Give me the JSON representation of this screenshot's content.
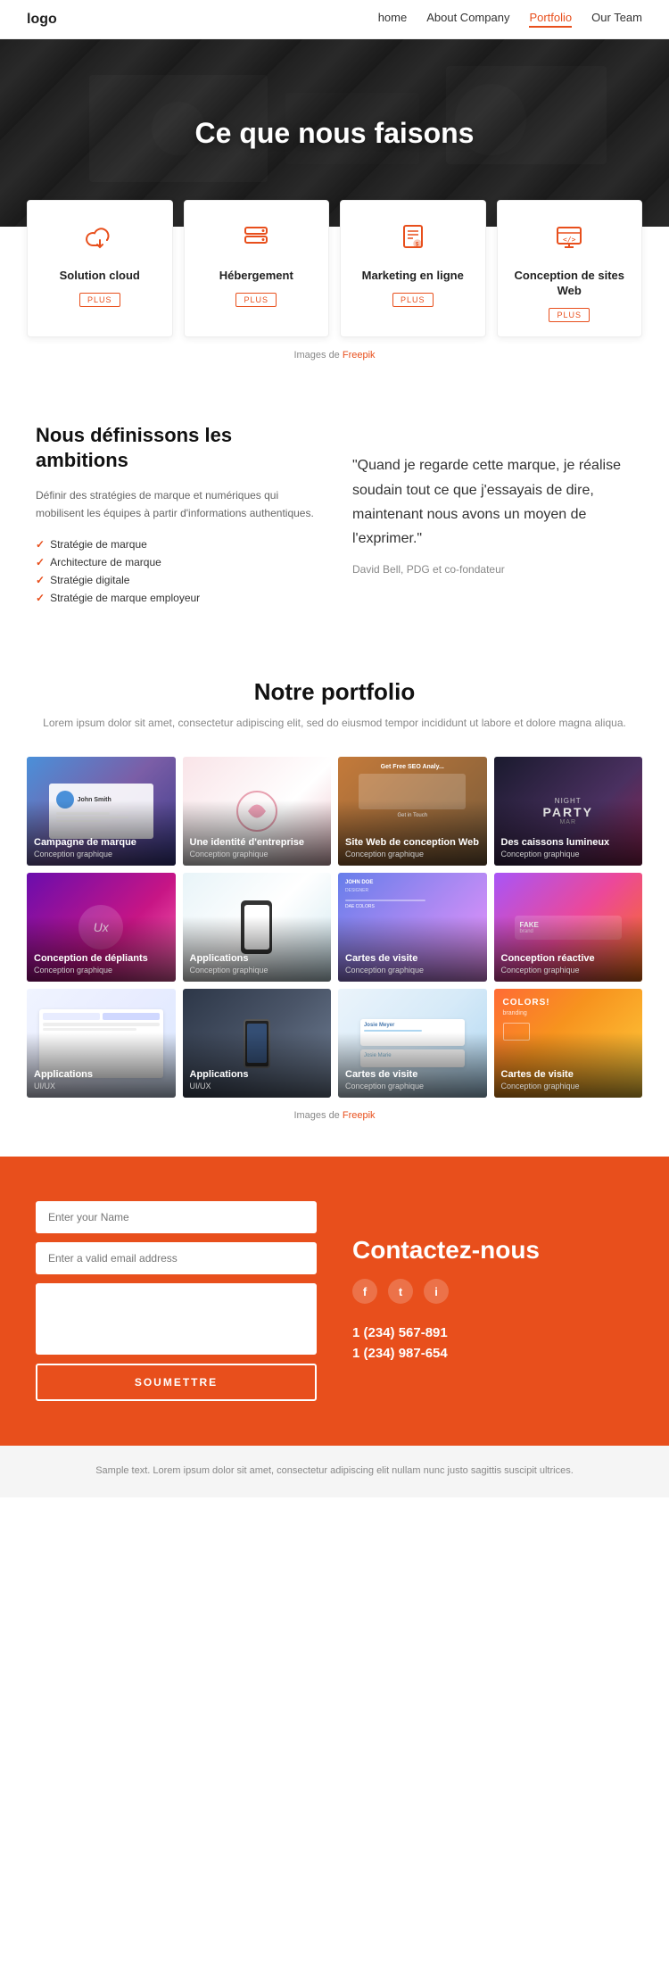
{
  "navbar": {
    "logo": "logo",
    "links": [
      {
        "label": "home",
        "href": "#",
        "active": false
      },
      {
        "label": "About Company",
        "href": "#",
        "active": false
      },
      {
        "label": "Portfolio",
        "href": "#",
        "active": true
      },
      {
        "label": "Our Team",
        "href": "#",
        "active": false
      }
    ]
  },
  "hero": {
    "title": "Ce que nous faisons"
  },
  "services": {
    "items": [
      {
        "icon": "☁",
        "title": "Solution cloud",
        "plus": "PLUS"
      },
      {
        "icon": "▤",
        "title": "Hébergement",
        "plus": "PLUS"
      },
      {
        "icon": "☰",
        "title": "Marketing en ligne",
        "plus": "PLUS"
      },
      {
        "icon": "</>",
        "title": "Conception de sites Web",
        "plus": "PLUS"
      }
    ],
    "credit": "Images de ",
    "credit_link": "Freepik"
  },
  "about": {
    "left_title": "Nous définissons les ambitions",
    "left_desc": "Définir des stratégies de marque et numériques qui mobilisent les équipes à partir d'informations authentiques.",
    "list_items": [
      "Stratégie de marque",
      "Architecture de marque",
      "Stratégie digitale",
      "Stratégie de marque employeur"
    ],
    "quote": "\"Quand je regarde cette marque, je réalise soudain tout ce que j'essayais de dire, maintenant nous avons un moyen de l'exprimer.\"",
    "quote_author": "David Bell, PDG et co-fondateur"
  },
  "portfolio": {
    "title": "Notre portfolio",
    "subtitle": "Lorem ipsum dolor sit amet, consectetur adipiscing elit, sed do eiusmod tempor incididunt ut labore et dolore magna aliqua.",
    "items": [
      {
        "name": "Campagne de marque",
        "cat": "Conception graphique",
        "bg": "bg-blue-purple"
      },
      {
        "name": "Une identité d'entreprise",
        "cat": "Conception graphique",
        "bg": "bg-pink-white"
      },
      {
        "name": "Site Web de conception Web",
        "cat": "Conception graphique",
        "bg": "bg-photo"
      },
      {
        "name": "Des caissons lumineux",
        "cat": "Conception graphique",
        "bg": "bg-dark-party"
      },
      {
        "name": "Conception de dépliants",
        "cat": "Conception graphique",
        "bg": "bg-purple-vivid"
      },
      {
        "name": "Applications",
        "cat": "Conception graphique",
        "bg": "bg-phone-white"
      },
      {
        "name": "Cartes de visite",
        "cat": "Conception graphique",
        "bg": "bg-colorful-card"
      },
      {
        "name": "Conception réactive",
        "cat": "Conception graphique",
        "bg": "bg-purple-orange"
      },
      {
        "name": "Applications",
        "cat": "UI/UX",
        "bg": "bg-light-app"
      },
      {
        "name": "Applications",
        "cat": "UI/UX",
        "bg": "bg-phone-hand"
      },
      {
        "name": "Cartes de visite",
        "cat": "Conception graphique",
        "bg": "bg-card-blue"
      },
      {
        "name": "Cartes de visite",
        "cat": "Conception graphique",
        "bg": "bg-colors-brand"
      }
    ],
    "credit": "Images de ",
    "credit_link": "Freepik"
  },
  "contact": {
    "title": "Contactez-nous",
    "form": {
      "name_placeholder": "Enter your Name",
      "email_placeholder": "Enter a valid email address",
      "submit_label": "SOUMETTRE"
    },
    "social": [
      "f",
      "t",
      "i"
    ],
    "phones": [
      "1 (234) 567-891",
      "1 (234) 987-654"
    ]
  },
  "footer": {
    "text": "Sample text. Lorem ipsum dolor sit amet, consectetur adipiscing elit nullam nunc justo sagittis suscipit ultrices."
  }
}
